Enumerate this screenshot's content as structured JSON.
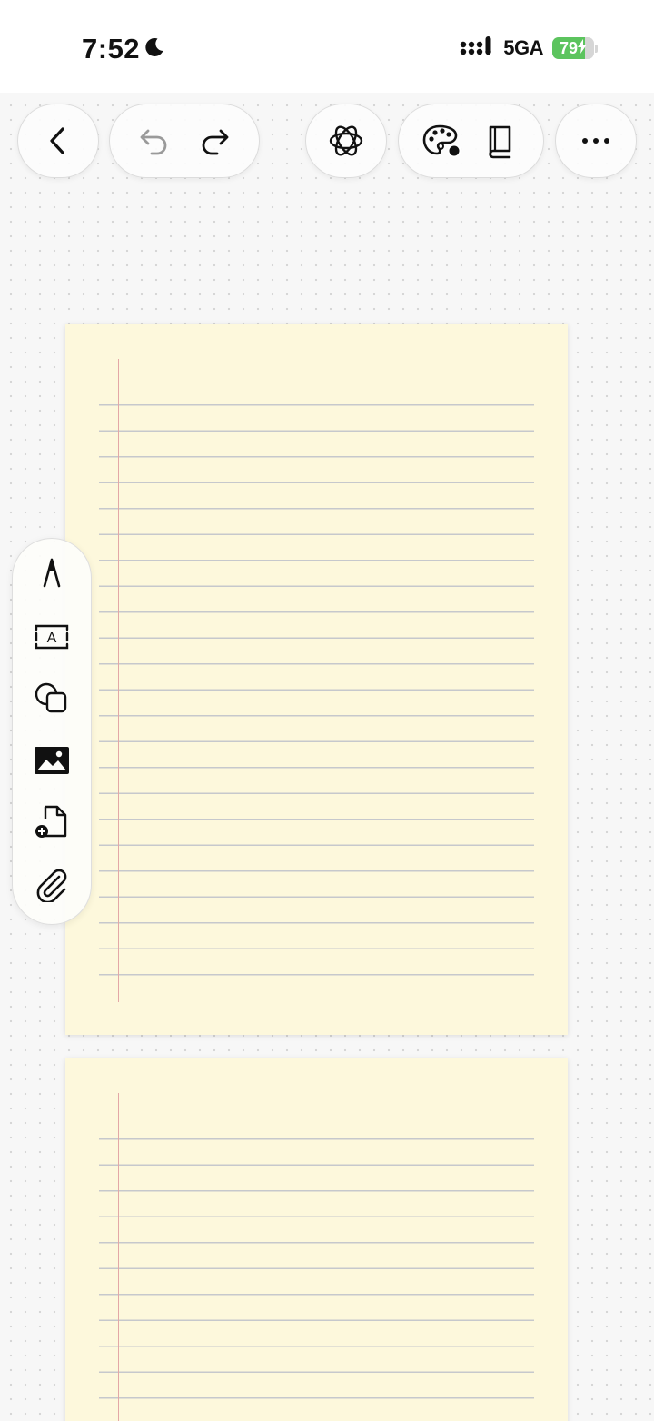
{
  "status_bar": {
    "time": "7:52",
    "network": "5GA",
    "battery_percent": "79",
    "battery_level": 0.79,
    "icons": [
      "moon-icon",
      "signal-icon",
      "battery-charging-icon"
    ]
  },
  "toolbar": {
    "icons": [
      "back-icon",
      "undo-icon",
      "redo-icon",
      "ai-assistant-icon",
      "palette-icon",
      "book-icon",
      "more-icon"
    ]
  },
  "tools": {
    "icons": [
      "pen-icon",
      "text-box-icon",
      "shapes-icon",
      "image-icon",
      "add-page-icon",
      "attachment-icon"
    ]
  },
  "canvas": {
    "page_color": "#fdf8dc",
    "rule_color": "#c6c8cc",
    "margin_color": "#e3a7a7",
    "background_color": "#f7f7f7"
  }
}
